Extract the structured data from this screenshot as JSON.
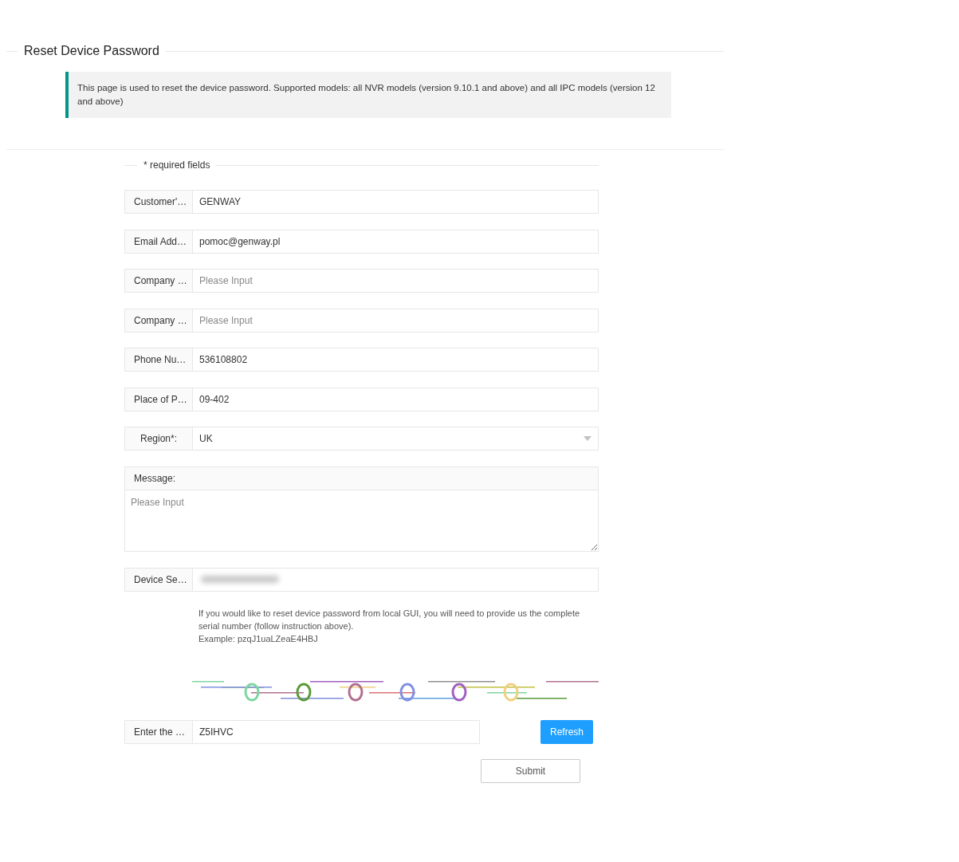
{
  "title": "Reset Device Password",
  "notice": "This page is used to reset the device password. Supported models: all NVR models (version 9.10.1 and above) and all IPC models (version 12 and above)",
  "required_note": "* required fields",
  "fields": [
    {
      "kind": "input",
      "label": "Customer'…",
      "value": "GENWAY"
    },
    {
      "kind": "input",
      "label": "Email Add…",
      "value": "pomoc@genway.pl"
    },
    {
      "kind": "input",
      "label": "Company …",
      "placeholder": "Please Input"
    },
    {
      "kind": "input",
      "label": "Company …",
      "placeholder": "Please Input"
    },
    {
      "kind": "input",
      "label": "Phone Nu…",
      "value": "536108802"
    },
    {
      "kind": "input",
      "label": "Place of P…",
      "value": "09-402"
    },
    {
      "kind": "select",
      "label": "Region*:",
      "value": "UK"
    },
    {
      "kind": "textarea",
      "label": "Message:",
      "placeholder": "Please Input"
    },
    {
      "kind": "redacted",
      "label": "Device Se…"
    }
  ],
  "help_lines": [
    "If you would like to reset device password from local GUI, you will need to provide us the complete serial number (follow instruction above).",
    "Example: pzqJ1uaLZeaE4HBJ"
  ],
  "captcha_field": {
    "label": "Enter the …",
    "value": "Z5IHVC"
  },
  "refresh_button": "Refresh",
  "submit_button": "Submit"
}
